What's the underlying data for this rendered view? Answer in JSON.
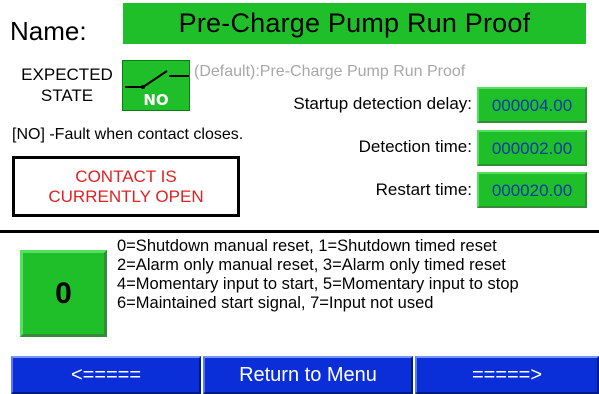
{
  "name_label": "Name:",
  "name_value": "Pre-Charge Pump Run Proof",
  "expected_state": {
    "line1": "EXPECTED",
    "line2": "STATE"
  },
  "switch_badge": "NO",
  "default_text": "(Default):Pre-Charge Pump Run Proof",
  "fault_text": "[NO] -Fault when contact closes.",
  "status": {
    "line1": "CONTACT IS",
    "line2": "CURRENTLY OPEN"
  },
  "params": [
    {
      "label": "Startup detection delay:",
      "value": "000004.00"
    },
    {
      "label": "Detection time:",
      "value": "000002.00"
    },
    {
      "label": "Restart time:",
      "value": "000020.00"
    }
  ],
  "mode_code": "0",
  "mode_options": [
    "0=Shutdown manual reset, 1=Shutdown timed reset",
    "2=Alarm only manual reset, 3=Alarm only timed reset",
    "4=Momentary input to start, 5=Momentary input to stop",
    "6=Maintained start signal, 7=Input not used"
  ],
  "nav": {
    "prev": "<=====",
    "menu": "Return to Menu",
    "next": "=====>"
  },
  "colors": {
    "green": "#1fbf2a",
    "blue": "#0a2fd8",
    "red": "#e02222",
    "value_text": "#0a3aa8"
  }
}
